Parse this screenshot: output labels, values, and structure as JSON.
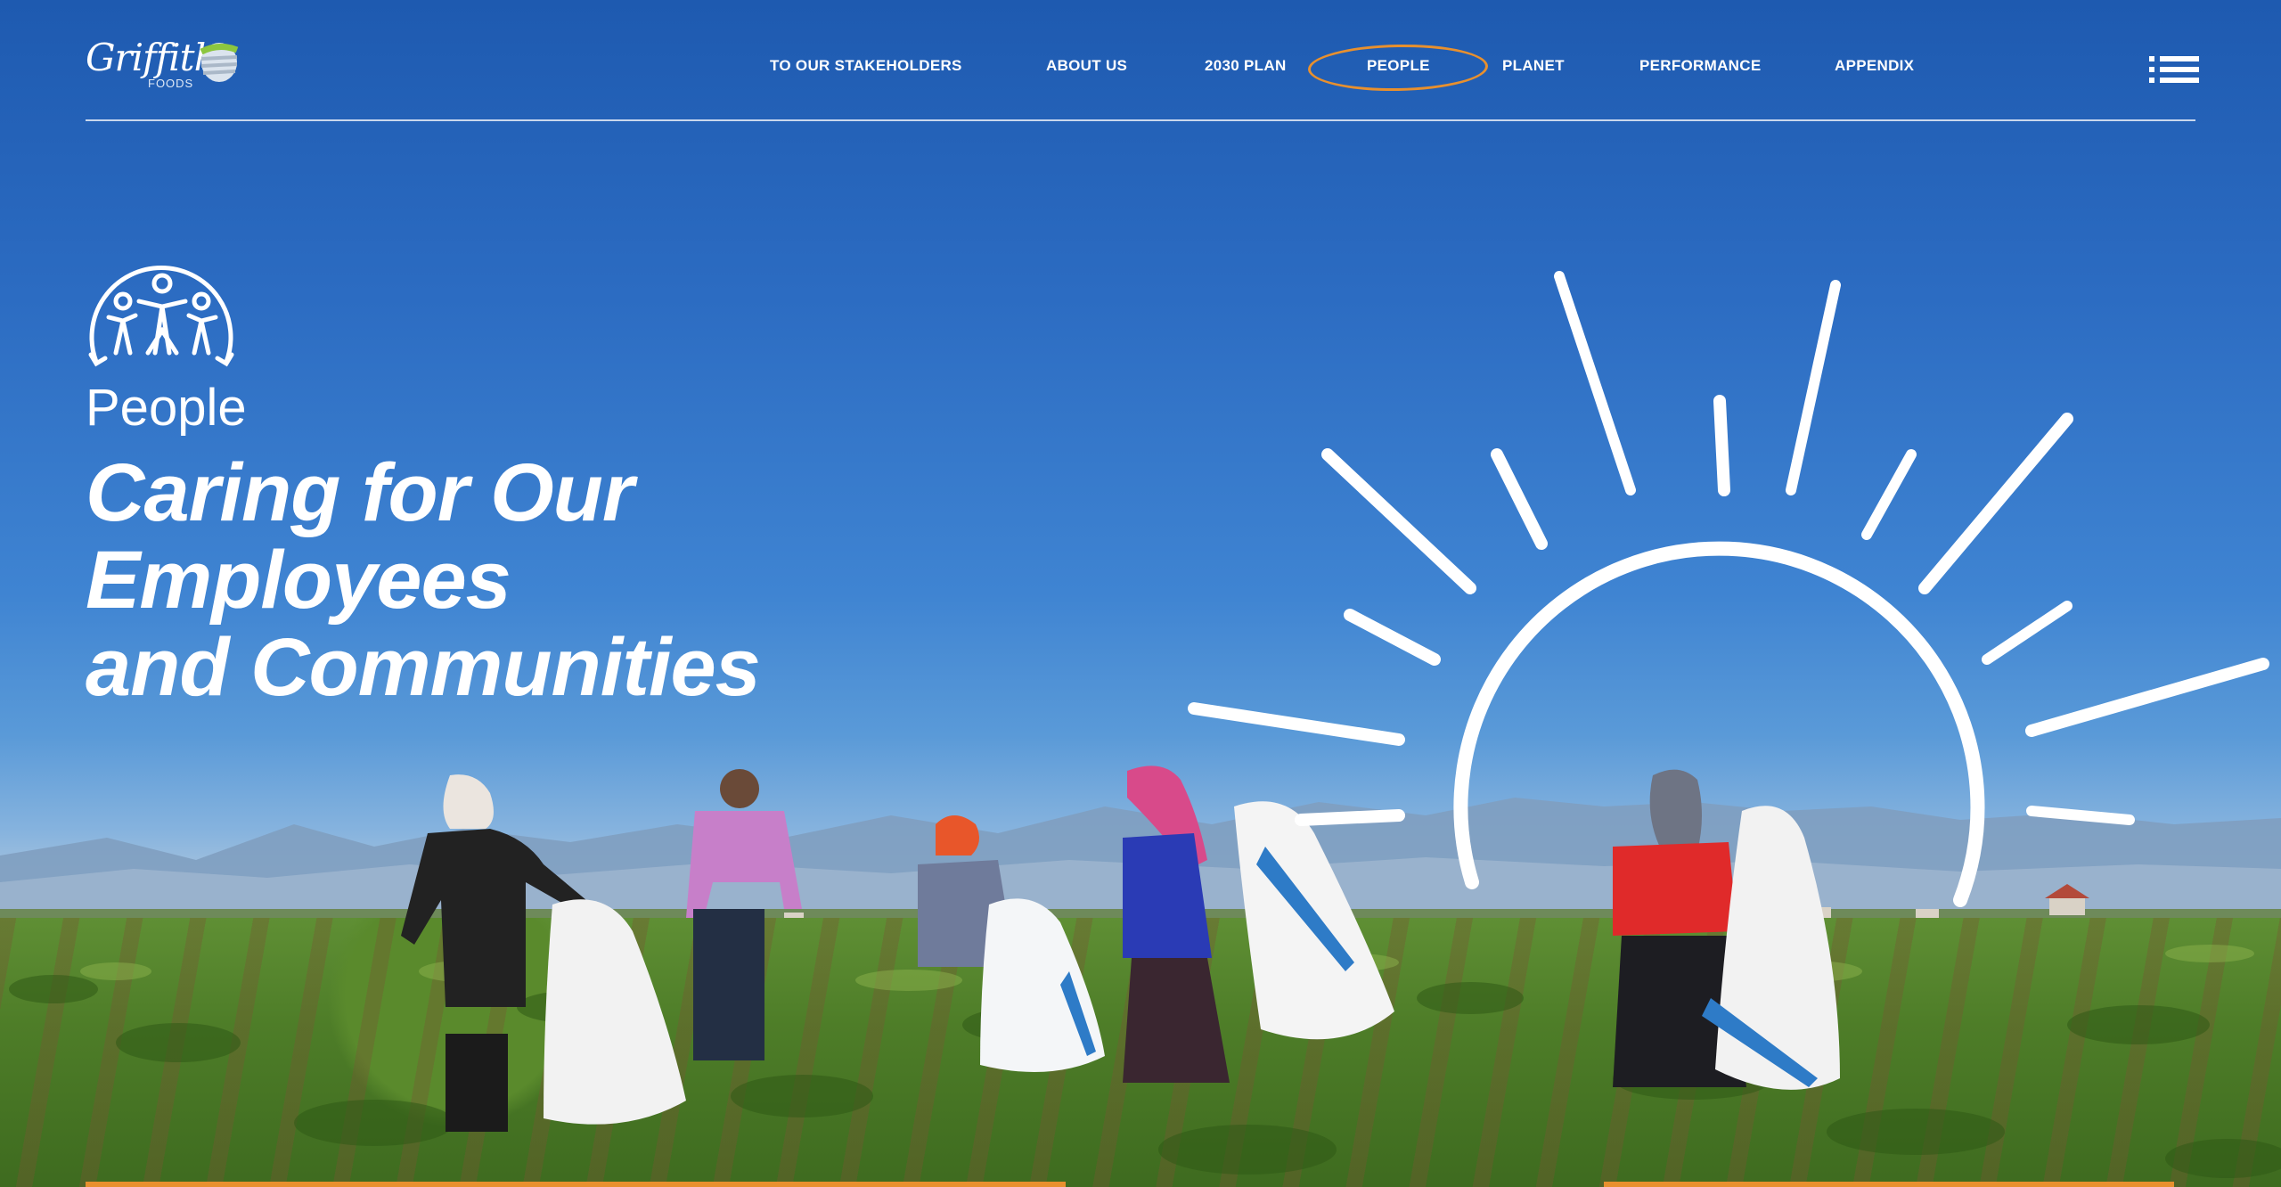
{
  "brand": {
    "name": "Griffith",
    "sub": "FOODS"
  },
  "nav": {
    "items": [
      {
        "label": "TO OUR STAKEHOLDERS"
      },
      {
        "label": "ABOUT US"
      },
      {
        "label": "2030 PLAN"
      },
      {
        "label": "PEOPLE"
      },
      {
        "label": "PLANET"
      },
      {
        "label": "PERFORMANCE"
      },
      {
        "label": "APPENDIX"
      }
    ],
    "active": "PEOPLE"
  },
  "hero": {
    "section_label": "People",
    "headline_line1": "Caring for Our Employees",
    "headline_line2": "and Communities"
  },
  "icons": {
    "menu": "list-menu-icon",
    "people": "people-circle-icon",
    "sun": "sun-illustration"
  },
  "colors": {
    "accent": "#e8902e",
    "sky": "#2c6cc2",
    "logo_green": "#8cc63f"
  }
}
